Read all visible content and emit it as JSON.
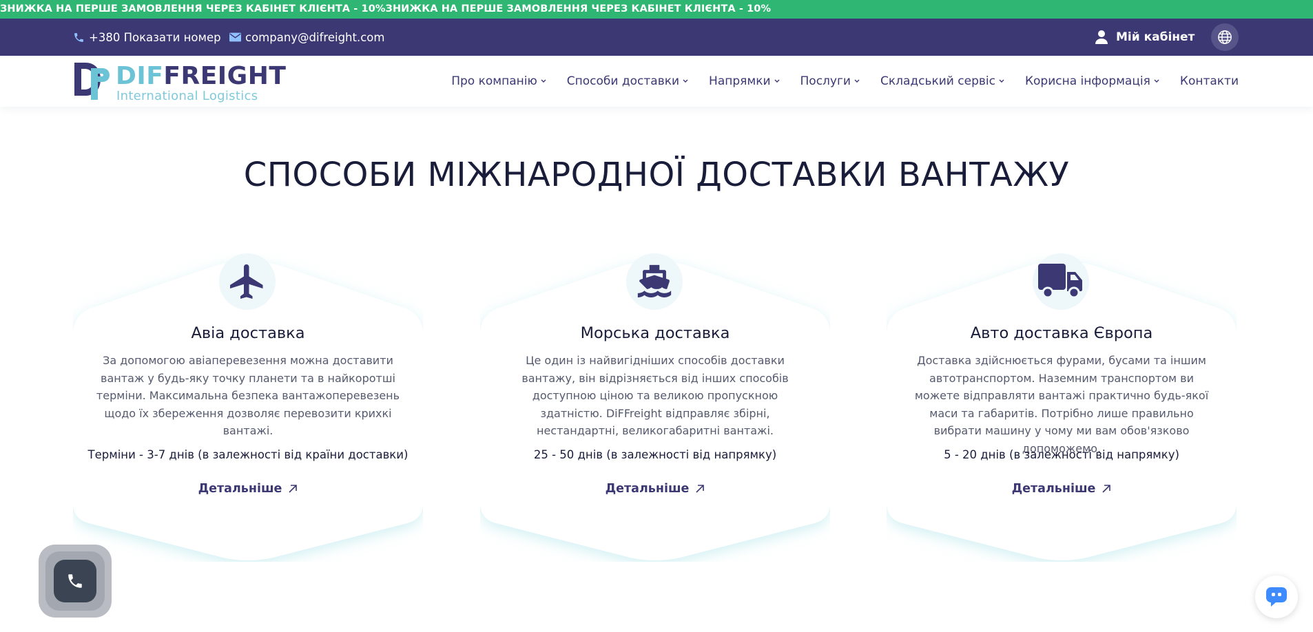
{
  "promo": {
    "text": "ЗНИЖКА НА ПЕРШЕ ЗАМОВЛЕННЯ ЧЕРЕЗ КАБІНЕТ КЛІЄНТА - 10%ЗНИЖКА НА ПЕРШЕ ЗАМОВЛЕННЯ ЧЕРЕЗ КАБІНЕТ КЛІЄНТА - 10%"
  },
  "topbar": {
    "phone": "+380 Показати номер",
    "email": "company@difreight.com",
    "cabinet": "Мій кабінет",
    "icons": [
      "phone-icon",
      "mail-icon",
      "user-icon",
      "globe-icon"
    ]
  },
  "header": {
    "logo_dif": "DIF",
    "logo_freight": "FREIGHT",
    "logo_sub": "International Logistics",
    "nav": [
      {
        "label": "Про компанію"
      },
      {
        "label": "Способи доставки"
      },
      {
        "label": "Напрямки"
      },
      {
        "label": "Послуги"
      },
      {
        "label": "Складський сервіс"
      },
      {
        "label": "Корисна інформація"
      },
      {
        "label": "Контакти"
      }
    ]
  },
  "main": {
    "title": "СПОСОБИ МІЖНАРОДНОЇ ДОСТАВКИ ВАНТАЖУ",
    "cards": [
      {
        "icon": "plane-icon",
        "title": "Авіа доставка",
        "description": "За допомогою авіаперевезення можна доставити вантаж у будь-яку точку планети та в найкоротші терміни. Максимальна безпека вантажоперевезень щодо їх збереження дозволяє перевозити крихкі вантажі.",
        "term": "Терміни - 3-7 днів (в залежності від країни доставки)",
        "link": "Детальніше"
      },
      {
        "icon": "ship-icon",
        "title": "Морська доставка",
        "description": "Це один із найвигідніших способів доставки вантажу, він відрізняється від інших способів доступною ціною та великою пропускною здатністю. DiFFreight відправляє збірні, нестандартні, великогабаритні вантажі.",
        "term": "25 - 50 днів (в залежності від напрямку)",
        "link": "Детальніше"
      },
      {
        "icon": "truck-icon",
        "title": "Авто доставка Європа",
        "description": "Доставка здійснюється фурами, бусами та іншим автотранспортом. Наземним транспортом ви можете відправляти вантажі практично будь-якої маси та габаритів. Потрібно лише правильно вибрати машину у чому ми вам обов'язково допоможемо.",
        "term": "5 - 20 днів (в залежності від напрямку)",
        "link": "Детальніше"
      }
    ]
  },
  "colors": {
    "promo_bg": "#2fb673",
    "topbar_bg": "#3b3874",
    "accent": "#3b3874",
    "logo_light": "#6cc3d6"
  }
}
